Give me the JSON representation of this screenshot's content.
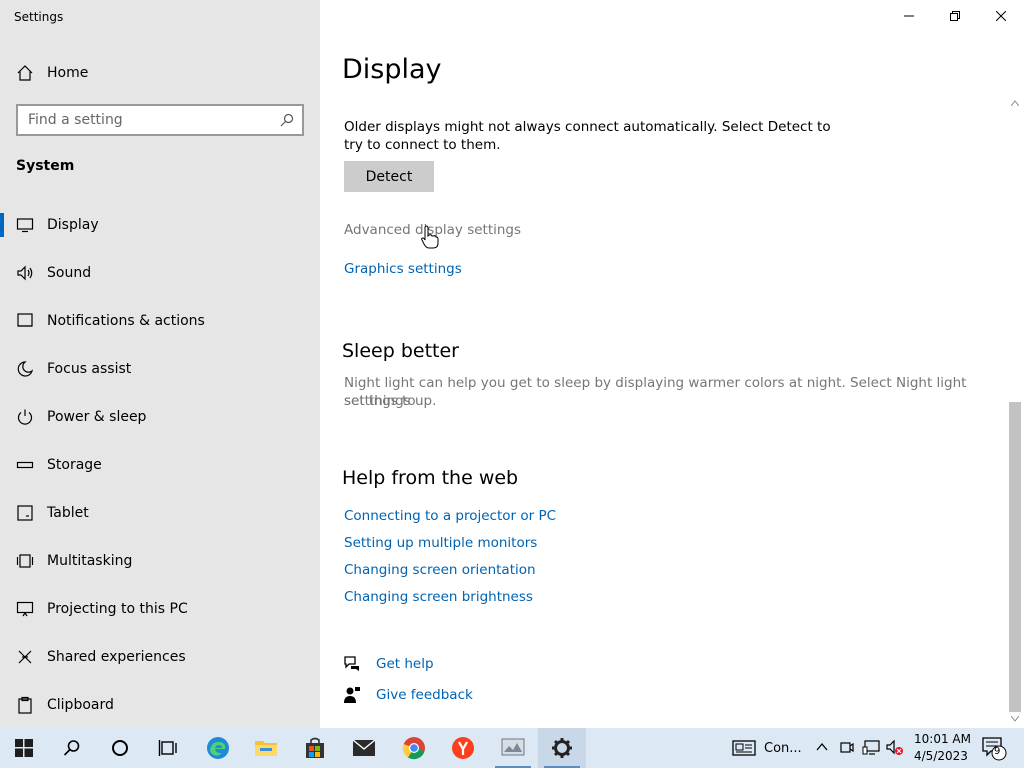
{
  "window": {
    "app_title": "Settings",
    "minimize_icon": "minimize-icon",
    "restore_icon": "restore-icon",
    "close_icon": "close-icon"
  },
  "sidebar": {
    "home_label": "Home",
    "search_placeholder": "Find a setting",
    "section_label": "System",
    "items": [
      {
        "label": "Display",
        "icon": "monitor-icon",
        "active": true
      },
      {
        "label": "Sound",
        "icon": "speaker-icon",
        "active": false
      },
      {
        "label": "Notifications & actions",
        "icon": "notification-icon",
        "active": false
      },
      {
        "label": "Focus assist",
        "icon": "moon-icon",
        "active": false
      },
      {
        "label": "Power & sleep",
        "icon": "power-icon",
        "active": false
      },
      {
        "label": "Storage",
        "icon": "storage-icon",
        "active": false
      },
      {
        "label": "Tablet",
        "icon": "tablet-icon",
        "active": false
      },
      {
        "label": "Multitasking",
        "icon": "multitasking-icon",
        "active": false
      },
      {
        "label": "Projecting to this PC",
        "icon": "projecting-icon",
        "active": false
      },
      {
        "label": "Shared experiences",
        "icon": "shared-icon",
        "active": false
      },
      {
        "label": "Clipboard",
        "icon": "clipboard-icon",
        "active": false
      }
    ]
  },
  "main": {
    "page_title": "Display",
    "detect_text_line1": "Older displays might not always connect automatically. Select Detect to",
    "detect_text_line2": "try to connect to them.",
    "detect_button": "Detect",
    "advanced_link": "Advanced display settings",
    "graphics_link": "Graphics settings",
    "sleep_heading": "Sleep better",
    "sleep_text_line1": "Night light can help you get to sleep by displaying warmer colors at night. Select Night light settings to",
    "sleep_text_line2": "set things up.",
    "help_heading": "Help from the web",
    "help_links": [
      "Connecting to a projector or PC",
      "Setting up multiple monitors",
      "Changing screen orientation",
      "Changing screen brightness"
    ],
    "get_help": "Get help",
    "give_feedback": "Give feedback"
  },
  "taskbar": {
    "apps": [
      {
        "name": "start-icon"
      },
      {
        "name": "search-icon"
      },
      {
        "name": "cortana-icon"
      },
      {
        "name": "task-view-icon"
      },
      {
        "name": "edge-icon"
      },
      {
        "name": "file-explorer-icon"
      },
      {
        "name": "store-icon"
      },
      {
        "name": "mail-icon"
      },
      {
        "name": "chrome-icon"
      },
      {
        "name": "yandex-icon"
      },
      {
        "name": "app-icon"
      },
      {
        "name": "settings-icon"
      }
    ],
    "news_label": "Con...",
    "time": "10:01 AM",
    "date": "4/5/2023",
    "notification_count": "9"
  },
  "colors": {
    "accent": "#0067c0",
    "link": "#0063b1",
    "sidebar_bg": "#e6e6e6",
    "taskbar_bg": "#dce9f5"
  }
}
